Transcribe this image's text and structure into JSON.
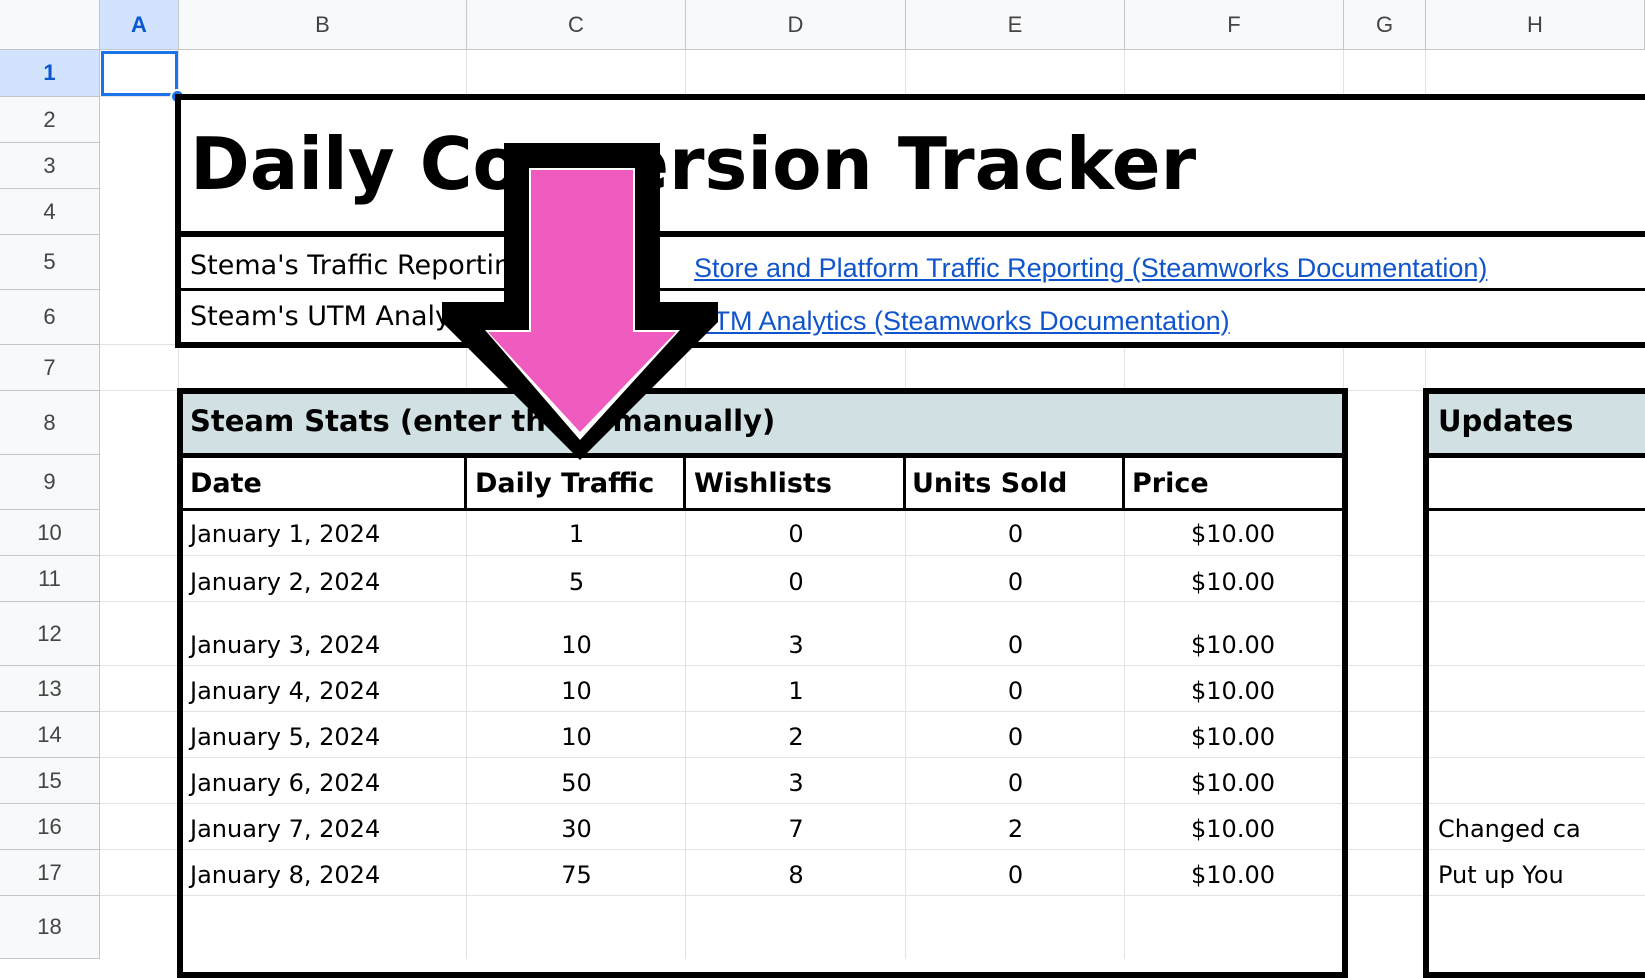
{
  "columns": [
    "A",
    "B",
    "C",
    "D",
    "E",
    "F",
    "G",
    "H"
  ],
  "rows": [
    "1",
    "2",
    "3",
    "4",
    "5",
    "6",
    "7",
    "8",
    "9",
    "10",
    "11",
    "12",
    "13",
    "14",
    "15",
    "16",
    "17",
    "18"
  ],
  "title": "Daily Conversion Tracker",
  "links": [
    {
      "label": "Stema's Traffic Reporting",
      "url_text": "Store and Platform Traffic Reporting (Steamworks Documentation)"
    },
    {
      "label": "Steam's UTM Analytics",
      "url_text": "UTM Analytics (Steamworks Documentation)"
    }
  ],
  "stats": {
    "header": "Steam Stats (enter these manually)",
    "columns": [
      "Date",
      "Daily Traffic",
      "Wishlists",
      "Units Sold",
      "Price"
    ],
    "rows": [
      [
        "January 1, 2024",
        "1",
        "0",
        "0",
        "$10.00"
      ],
      [
        "January 2, 2024",
        "5",
        "0",
        "0",
        "$10.00"
      ],
      [
        "January 3, 2024",
        "10",
        "3",
        "0",
        "$10.00"
      ],
      [
        "January 4, 2024",
        "10",
        "1",
        "0",
        "$10.00"
      ],
      [
        "January 5, 2024",
        "10",
        "2",
        "0",
        "$10.00"
      ],
      [
        "January 6, 2024",
        "50",
        "3",
        "0",
        "$10.00"
      ],
      [
        "January 7, 2024",
        "30",
        "7",
        "2",
        "$10.00"
      ],
      [
        "January 8, 2024",
        "75",
        "8",
        "0",
        "$10.00"
      ]
    ]
  },
  "updates": {
    "header": "Updates",
    "notes": [
      "Changed ca",
      "Put up You"
    ]
  },
  "colors": {
    "selection": "#1a73e8",
    "cursor": "#f05bbf",
    "section_header_bg": "#d0e0e3",
    "link": "#1155cc"
  }
}
